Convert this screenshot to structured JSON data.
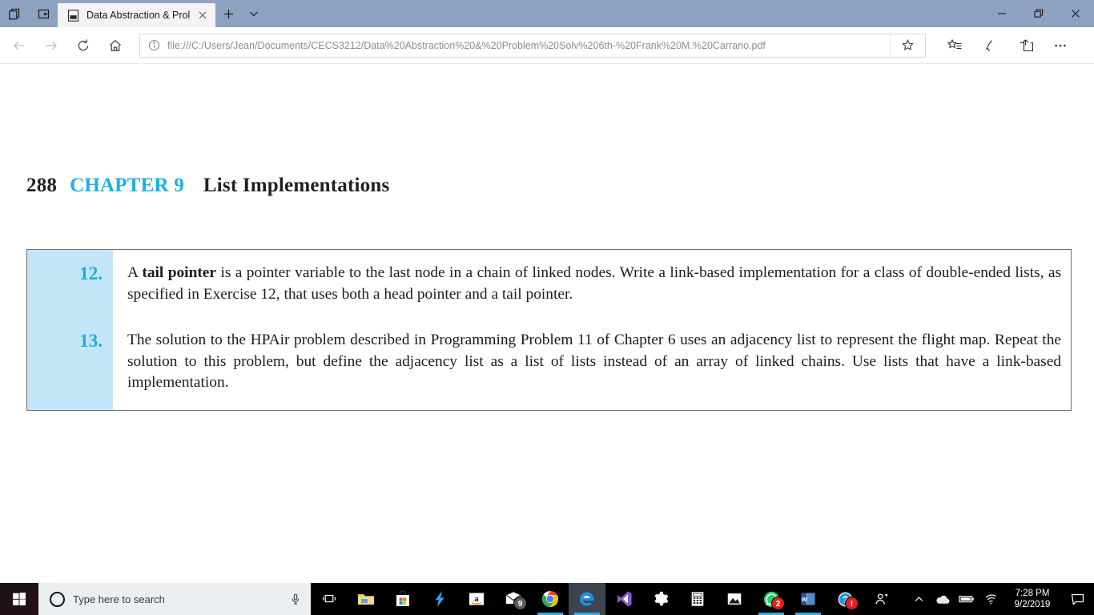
{
  "browser": {
    "window_controls": {
      "minimize": "minimize-icon",
      "restore": "restore-icon",
      "close": "close-icon"
    },
    "system_buttons": [
      {
        "name": "tab-preview-icon",
        "label": ""
      },
      {
        "name": "set-tabs-aside-icon",
        "label": ""
      }
    ],
    "tab": {
      "title": "Data Abstraction & Prol",
      "favicon": "pdf-file-icon",
      "close": "close-icon"
    },
    "new_tab_label": "+",
    "tab_dropdown": "chevron-down-icon",
    "nav": {
      "back": "back-arrow-icon",
      "forward": "forward-arrow-icon",
      "refresh": "refresh-icon",
      "home": "home-icon"
    },
    "address": {
      "info_icon": "info-circle-icon",
      "url": "file:///C:/Users/Jean/Documents/CECS3212/Data%20Abstraction%20&%20Problem%20Solv%206th-%20Frank%20M.%20Carrano.pdf",
      "favorite_icon": "star-outline-icon"
    },
    "toolbar": [
      {
        "name": "favorites-reading-list-icon"
      },
      {
        "name": "notes-pen-icon"
      },
      {
        "name": "share-icon"
      },
      {
        "name": "more-options-icon"
      }
    ]
  },
  "document": {
    "header": {
      "page_number": "288",
      "chapter": "CHAPTER 9",
      "chapter_title": "List Implementations",
      "chapter_color": "#1ab0e8"
    },
    "exercise_block": {
      "rail_color": "#c3e5f7",
      "number_color": "#18ace3",
      "items": [
        {
          "number": "12.",
          "text_before_bold": "A ",
          "bold": "tail pointer",
          "text_after_bold": " is a pointer variable to the last node in a chain of linked nodes. Write a link-based implementation for a class of double-ended lists, as specified in Exercise 12, that uses both a head pointer and a tail pointer."
        },
        {
          "number": "13.",
          "text_before_bold": "The solution to the HPAir problem described in Programming Problem 11 of Chapter 6 uses an adjacency list to represent the flight map. Repeat the solution to this problem, but define the adjacency list as a list of lists instead of an array of linked chains. Use lists that have a link-based implementation.",
          "bold": "",
          "text_after_bold": ""
        }
      ]
    }
  },
  "taskbar": {
    "start": "windows-start-icon",
    "search": {
      "placeholder": "Type here to search",
      "cortana_icon": "cortana-circle-icon",
      "mic_icon": "microphone-icon"
    },
    "task_view": "task-view-icon",
    "pinned": [
      {
        "name": "file-explorer-icon",
        "badge": "",
        "active": false
      },
      {
        "name": "microsoft-store-icon",
        "badge": "",
        "active": false
      },
      {
        "name": "lightning-bolt-app-icon",
        "badge": "",
        "active": false
      },
      {
        "name": "amazon-icon",
        "badge": "",
        "active": false
      },
      {
        "name": "mail-icon",
        "badge": "9",
        "badge_color": "grey",
        "active": false
      },
      {
        "name": "google-chrome-icon",
        "badge": "",
        "active": true
      },
      {
        "name": "microsoft-edge-icon",
        "badge": "",
        "active": true
      },
      {
        "name": "visual-studio-icon",
        "badge": "",
        "active": false
      },
      {
        "name": "settings-gear-icon",
        "badge": "",
        "active": false
      },
      {
        "name": "calculator-icon",
        "badge": "",
        "active": false
      },
      {
        "name": "photos-icon",
        "badge": "",
        "active": false
      },
      {
        "name": "whatsapp-icon",
        "badge": "2",
        "badge_color": "red",
        "active": true
      },
      {
        "name": "microsoft-word-icon",
        "badge": "",
        "active": true
      },
      {
        "name": "help-icon",
        "badge": "!",
        "badge_color": "red",
        "active": false
      },
      {
        "name": "people-contacts-icon",
        "badge": "",
        "active": false
      }
    ],
    "tray": {
      "show_hidden": "chevron-up-icon",
      "onedrive": "onedrive-cloud-icon",
      "battery": "battery-icon",
      "network": "wifi-icon",
      "time": "7:28 PM",
      "date": "9/2/2019",
      "action_center": "action-center-icon"
    }
  }
}
